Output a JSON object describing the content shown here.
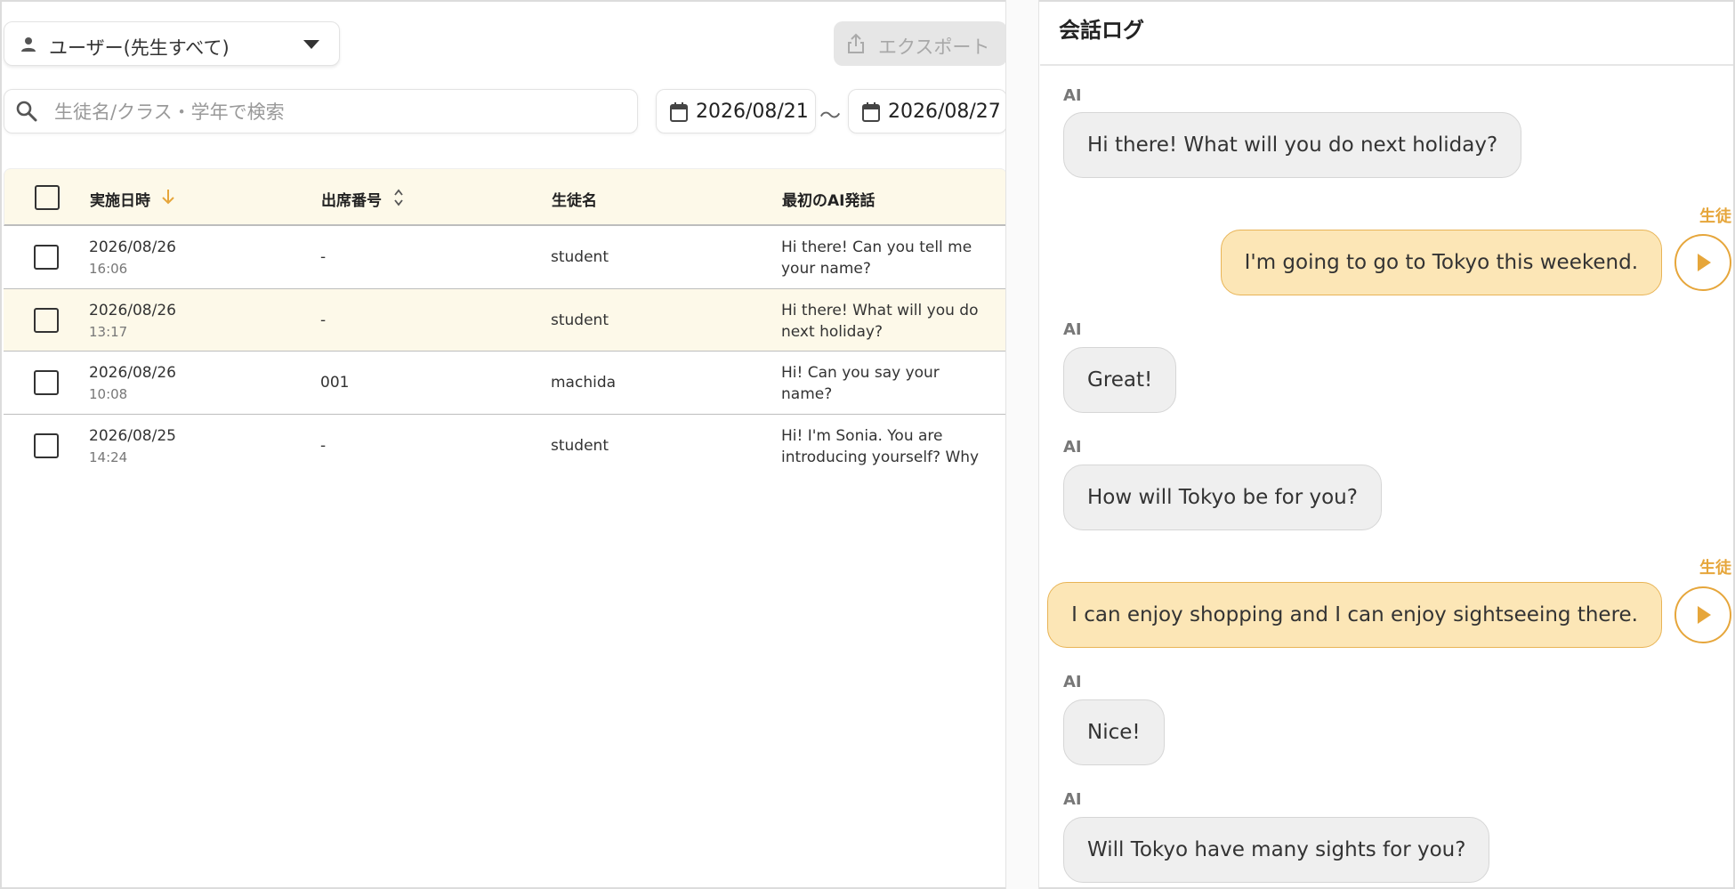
{
  "filters": {
    "user_select_label": "ユーザー(先生すべて)",
    "export_label": "エクスポート",
    "search_placeholder": "生徒名/クラス・学年で検索",
    "date_from": "2026/08/21",
    "date_separator": "〜",
    "date_to": "2026/08/27"
  },
  "table": {
    "headers": {
      "date": "実施日時",
      "number": "出席番号",
      "name": "生徒名",
      "first_ai": "最初のAI発話"
    },
    "rows": [
      {
        "date": "2026/08/26",
        "time": "16:06",
        "number": "-",
        "name": "student",
        "first_ai": "Hi there! Can you tell me your name?",
        "selected": false
      },
      {
        "date": "2026/08/26",
        "time": "13:17",
        "number": "-",
        "name": "student",
        "first_ai": "Hi there! What will you do next holiday?",
        "selected": true
      },
      {
        "date": "2026/08/26",
        "time": "10:08",
        "number": "001",
        "name": "machida",
        "first_ai": "Hi! Can you say your name?",
        "selected": false
      },
      {
        "date": "2026/08/25",
        "time": "14:24",
        "number": "-",
        "name": "student",
        "first_ai": "Hi! I'm Sonia. You are introducing yourself? Why",
        "selected": false
      }
    ]
  },
  "log": {
    "title": "会話ログ",
    "messages": [
      {
        "speaker": "AI",
        "text": "Hi there! What will you do next holiday?",
        "role": "ai"
      },
      {
        "speaker": "生徒",
        "text": "I'm going to go to Tokyo this weekend.",
        "role": "student"
      },
      {
        "speaker": "AI",
        "text": "Great!",
        "role": "ai"
      },
      {
        "speaker": "AI",
        "text": "How will Tokyo be for you?",
        "role": "ai"
      },
      {
        "speaker": "生徒",
        "text": "I can enjoy shopping and I can enjoy sightseeing there.",
        "role": "student"
      },
      {
        "speaker": "AI",
        "text": "Nice!",
        "role": "ai"
      },
      {
        "speaker": "AI",
        "text": "Will Tokyo have many sights for you?",
        "role": "ai"
      }
    ]
  },
  "colors": {
    "accent": "#e6a63b",
    "selected_row": "#fdf9e9",
    "student_bubble": "#fce6b6",
    "ai_bubble": "#efefef"
  },
  "icons": {
    "user": "person-icon",
    "dropdown": "caret-down-icon",
    "export": "share-icon",
    "search": "search-icon",
    "calendar": "calendar-icon",
    "sort_desc": "arrow-down-icon",
    "sort": "sort-icon",
    "play": "play-icon"
  }
}
